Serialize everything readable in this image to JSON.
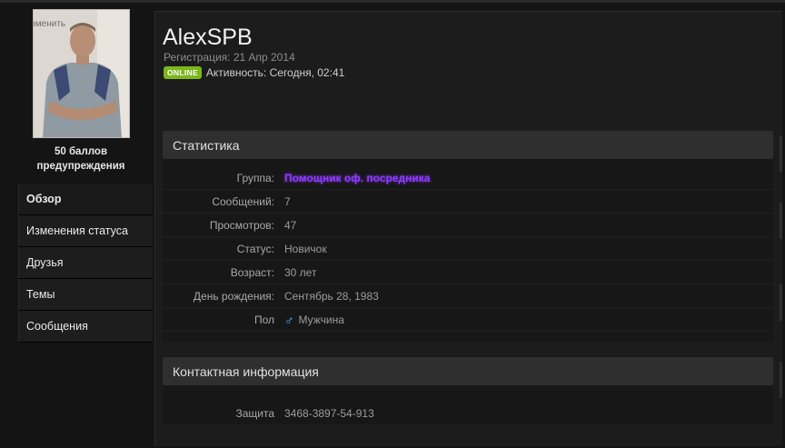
{
  "sidebar": {
    "avatar_edit": "Изменить",
    "warn_line1": "50 баллов",
    "warn_line2": "предупреждения",
    "nav": [
      {
        "label": "Обзор"
      },
      {
        "label": "Изменения статуса"
      },
      {
        "label": "Друзья"
      },
      {
        "label": "Темы"
      },
      {
        "label": "Сообщения"
      }
    ]
  },
  "profile": {
    "username": "AlexSPB",
    "registration": "Регистрация: 21 Апр 2014",
    "online_badge": "ONLINE",
    "activity": "Активность: Сегодня, 02:41"
  },
  "stats": {
    "title": "Статистика",
    "rows": [
      {
        "label": "Группа:",
        "value": "Помощник оф. посредника"
      },
      {
        "label": "Сообщений:",
        "value": "7"
      },
      {
        "label": "Просмотров:",
        "value": "47"
      },
      {
        "label": "Статус:",
        "value": "Новичок"
      },
      {
        "label": "Возраст:",
        "value": "30 лет"
      },
      {
        "label": "День рождения:",
        "value": "Сентябрь 28, 1983"
      },
      {
        "label": "Пол",
        "value": "Мужчина",
        "icon": "male-icon"
      }
    ]
  },
  "contact": {
    "title": "Контактная информация",
    "rows": [
      {
        "label": "Защита",
        "value": "3468-3897-54-913"
      }
    ]
  },
  "colors": {
    "group_color": "#8e3dff",
    "online_badge": "#7bb61c"
  }
}
